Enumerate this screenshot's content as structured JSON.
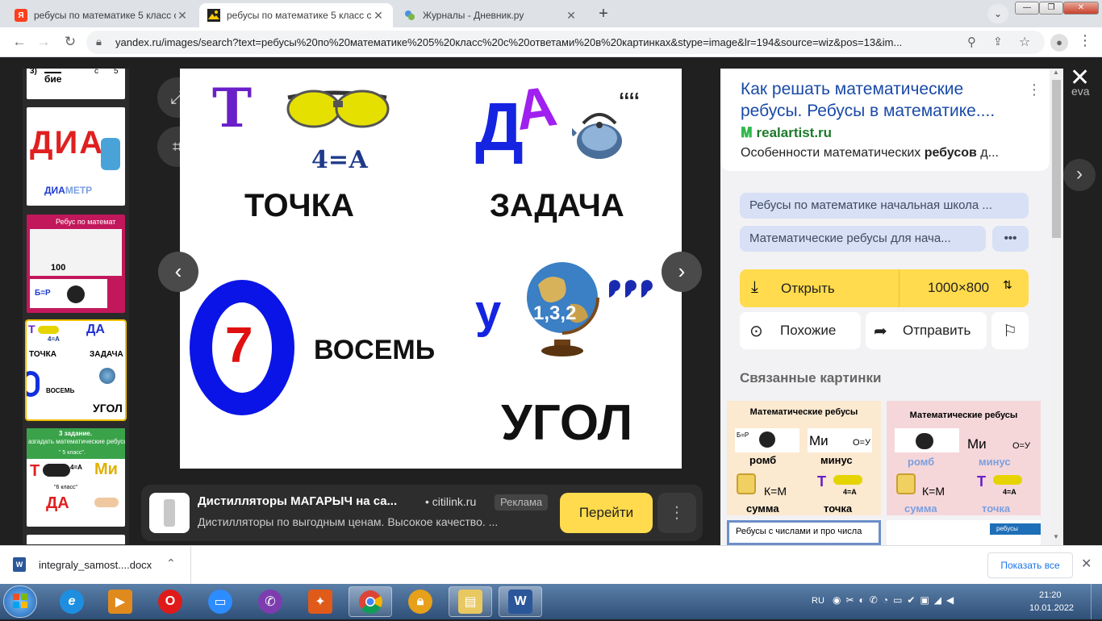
{
  "browser": {
    "tabs": [
      {
        "favicon": "Я",
        "title": "ребусы по математике 5 класс с",
        "active": false
      },
      {
        "favicon": "",
        "title": "ребусы по математике 5 класс с",
        "active": true
      },
      {
        "favicon": "",
        "title": "Журналы - Дневник.ру",
        "active": false
      }
    ],
    "new_tab_label": "+",
    "url": "yandex.ru/images/search?text=ребусы%20по%20математике%205%20класс%20с%20ответами%20в%20картинках&stype=image&lr=194&source=wiz&pos=13&im..."
  },
  "viewer": {
    "main_image": {
      "words": {
        "tochka": "ТОЧКА",
        "zadacha": "ЗАДАЧА",
        "vosem": "ВОСЕМЬ",
        "ugol": "УГОЛ"
      },
      "letters": {
        "t": "Т",
        "da": "ДА",
        "y": "у",
        "seven": "7",
        "commas_small": "‘‘‘‘",
        "commas_big": "   "
      },
      "formula_a": "4=А",
      "formula_globe": "1,3,2"
    },
    "ad": {
      "title": "Дистилляторы МАГАРЫЧ на са...",
      "domain": "citilink.ru",
      "badge": "Реклама",
      "description": "Дистилляторы по выгодным ценам. Высокое качество. ...",
      "button": "Перейти",
      "more": "⋮"
    }
  },
  "panel": {
    "title": "Как решать математические ребусы. Ребусы в математике....",
    "site": "realartist.ru",
    "snippet_prefix": "Особенности математических ",
    "snippet_bold": "ребусов",
    "snippet_suffix": " д...",
    "chips": [
      "Ребусы по математике начальная школа ...",
      "Математические ребусы для нача..."
    ],
    "more_chip": "•••",
    "open_label": "Открыть",
    "size_label": "1000×800",
    "similar_label": "Похожие",
    "share_label": "Отправить",
    "related_heading": "Связанные картинки",
    "related": [
      {
        "title": "Математические ребусы",
        "words": [
          "ромб",
          "минус",
          "сумма",
          "точка"
        ],
        "formulas": [
          "Б=Р",
          "О=У",
          "К=М",
          "4=А"
        ]
      },
      {
        "title": "Математические ребусы",
        "words": [
          "ромб",
          "минус",
          "сумма",
          "точка"
        ],
        "formulas": [
          "Б=Р",
          "О=У",
          "К=М",
          "4=А"
        ]
      }
    ],
    "related_more": "Ребусы с числами и про числа",
    "related_more2": "ребусы"
  },
  "thumbs": {
    "t1": [
      "3)",
      "бие",
      "с",
      "5"
    ],
    "t2": [
      "ДИА",
      "МЕТР"
    ],
    "t3": [
      "Ребус по математ",
      "100",
      "Б=Р"
    ],
    "t4": [
      "ТОЧКА",
      "ЗАДАЧА",
      "ВОСЕМЬ",
      "УГОЛ",
      "4=А"
    ],
    "t5": [
      "3 задание.",
      "азгадать математические ребусы",
      "\" 5 класс\".",
      "\"6 класс\"",
      "4=А",
      "Ми",
      "ДА"
    ]
  },
  "close_label": "✕",
  "edge_text": "eva",
  "downloads": {
    "file": "integraly_samost....docx",
    "show_all": "Показать все"
  },
  "taskbar": {
    "lang": "RU",
    "time": "21:20",
    "date": "10.01.2022"
  },
  "colors": {
    "accent_yellow": "#ffdb4d",
    "chip_bg": "#d7e0f5",
    "selection": "#f0c000"
  }
}
